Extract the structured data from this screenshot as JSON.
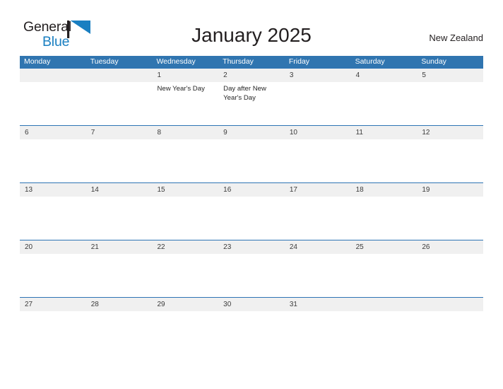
{
  "brand": {
    "line1": "General",
    "line2": "Blue",
    "flag_icon": "blue-flag-triangle",
    "color_dark": "#231f20",
    "color_blue": "#1a7fc1"
  },
  "header": {
    "title": "January 2025",
    "country": "New Zealand"
  },
  "theme": {
    "header_blue": "#3075b0",
    "rule_blue": "#2e74b4",
    "date_band_gray": "#f0f0f0",
    "text_dark": "#231f20"
  },
  "calendar": {
    "day_headers": [
      "Monday",
      "Tuesday",
      "Wednesday",
      "Thursday",
      "Friday",
      "Saturday",
      "Sunday"
    ],
    "weeks": [
      {
        "days": [
          {
            "num": "",
            "events": []
          },
          {
            "num": "",
            "events": []
          },
          {
            "num": "1",
            "events": [
              "New Year's Day"
            ]
          },
          {
            "num": "2",
            "events": [
              "Day after New Year's Day"
            ]
          },
          {
            "num": "3",
            "events": []
          },
          {
            "num": "4",
            "events": []
          },
          {
            "num": "5",
            "events": []
          }
        ]
      },
      {
        "days": [
          {
            "num": "6",
            "events": []
          },
          {
            "num": "7",
            "events": []
          },
          {
            "num": "8",
            "events": []
          },
          {
            "num": "9",
            "events": []
          },
          {
            "num": "10",
            "events": []
          },
          {
            "num": "11",
            "events": []
          },
          {
            "num": "12",
            "events": []
          }
        ]
      },
      {
        "days": [
          {
            "num": "13",
            "events": []
          },
          {
            "num": "14",
            "events": []
          },
          {
            "num": "15",
            "events": []
          },
          {
            "num": "16",
            "events": []
          },
          {
            "num": "17",
            "events": []
          },
          {
            "num": "18",
            "events": []
          },
          {
            "num": "19",
            "events": []
          }
        ]
      },
      {
        "days": [
          {
            "num": "20",
            "events": []
          },
          {
            "num": "21",
            "events": []
          },
          {
            "num": "22",
            "events": []
          },
          {
            "num": "23",
            "events": []
          },
          {
            "num": "24",
            "events": []
          },
          {
            "num": "25",
            "events": []
          },
          {
            "num": "26",
            "events": []
          }
        ]
      },
      {
        "days": [
          {
            "num": "27",
            "events": []
          },
          {
            "num": "28",
            "events": []
          },
          {
            "num": "29",
            "events": []
          },
          {
            "num": "30",
            "events": []
          },
          {
            "num": "31",
            "events": []
          },
          {
            "num": "",
            "events": []
          },
          {
            "num": "",
            "events": []
          }
        ]
      }
    ]
  }
}
